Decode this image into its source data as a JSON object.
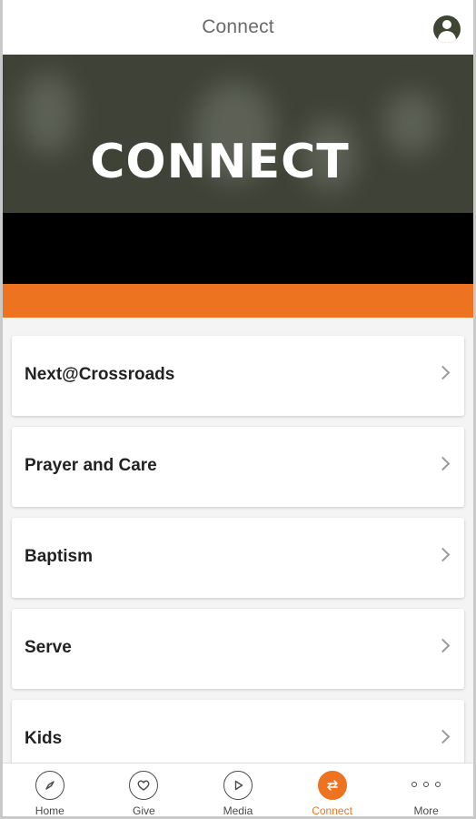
{
  "header": {
    "title": "Connect",
    "profile_icon": "person-circle-icon"
  },
  "hero": {
    "heading": "CONNECT"
  },
  "colors": {
    "accent": "#ee7321",
    "profile": "#3f4634"
  },
  "menu": {
    "items": [
      {
        "label": "Next@Crossroads"
      },
      {
        "label": "Prayer and Care"
      },
      {
        "label": "Baptism"
      },
      {
        "label": "Serve"
      },
      {
        "label": "Kids"
      }
    ]
  },
  "tabbar": {
    "tabs": [
      {
        "label": "Home",
        "icon": "compass-icon"
      },
      {
        "label": "Give",
        "icon": "heart-icon"
      },
      {
        "label": "Media",
        "icon": "play-icon"
      },
      {
        "label": "Connect",
        "icon": "swap-arrows-icon",
        "active": true
      },
      {
        "label": "More",
        "icon": "more-dots-icon"
      }
    ]
  }
}
